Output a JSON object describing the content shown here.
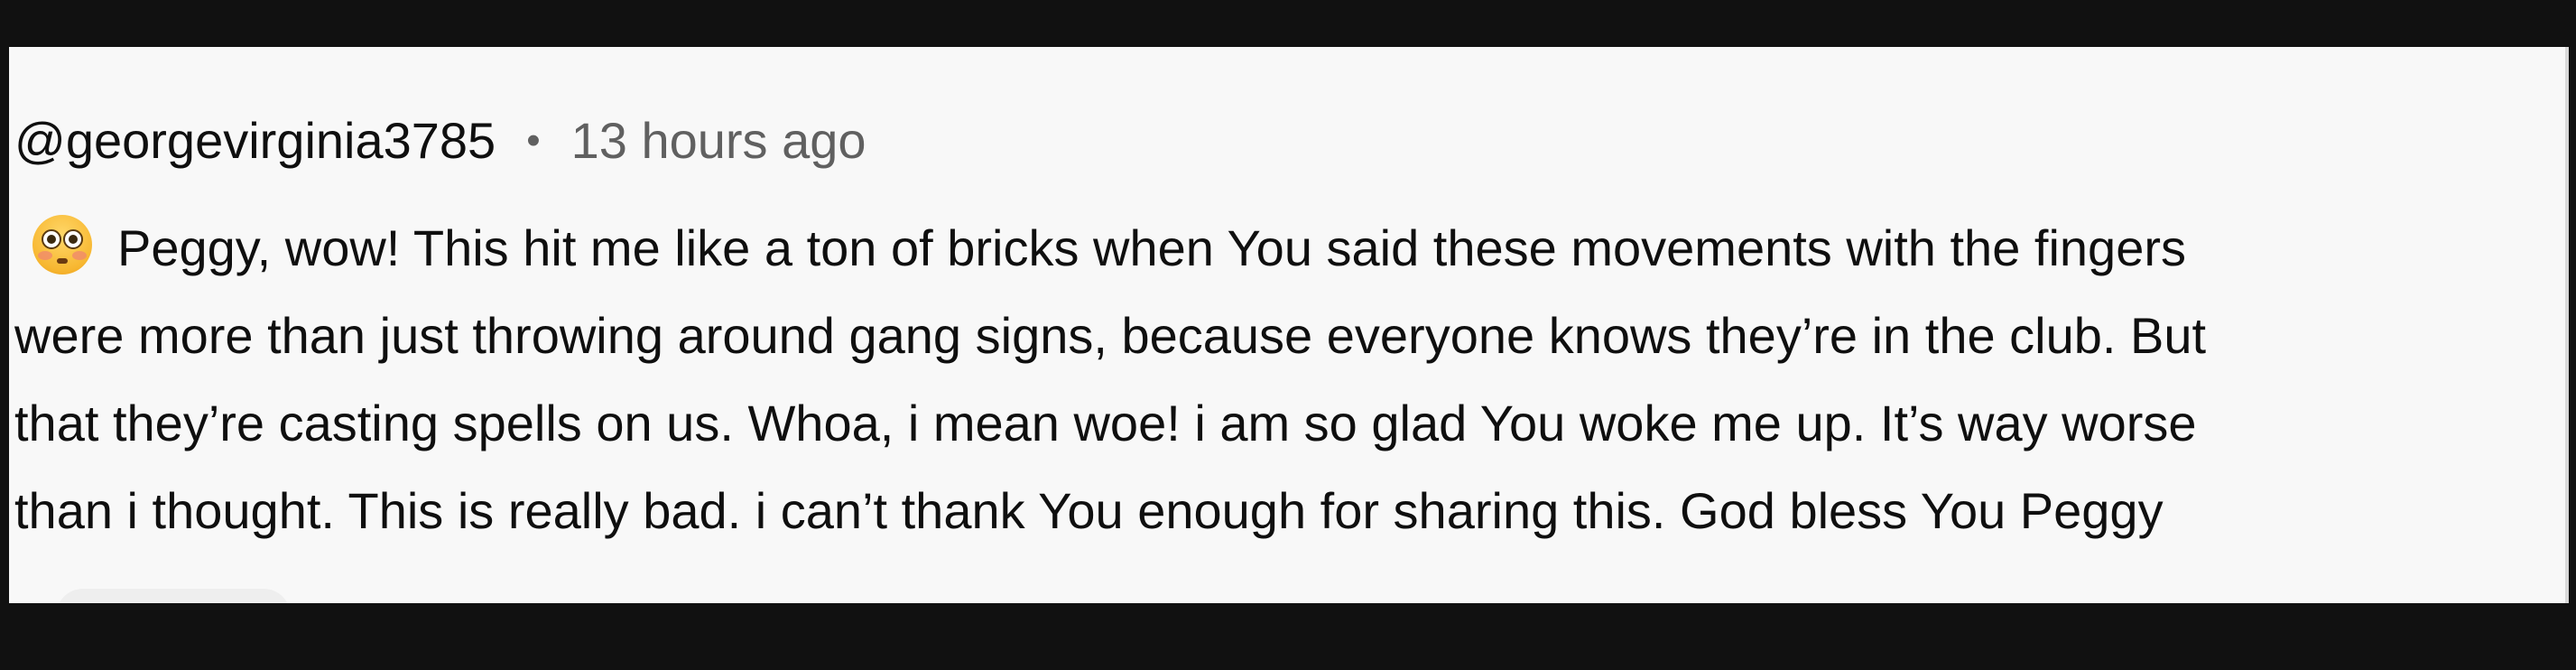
{
  "comment": {
    "author": "@georgevirginia3785",
    "separator": "•",
    "timestamp": "13 hours ago",
    "emoji": "flushed-face",
    "lines": [
      "Peggy, wow! This hit me like a ton of bricks when You said these movements with the fingers",
      "were more than just throwing around gang signs, because everyone knows they’re in the club. But",
      "that they’re casting spells on us. Whoa, i mean woe! i am so glad You woke me up. It’s way worse",
      "than i thought. This is really bad. i can’t thank You enough for sharing this. God bless You Peggy"
    ]
  },
  "colors": {
    "background": "#f8f8f8",
    "frame": "#111111",
    "text_primary": "#0f0f0f",
    "text_secondary": "#606060"
  }
}
